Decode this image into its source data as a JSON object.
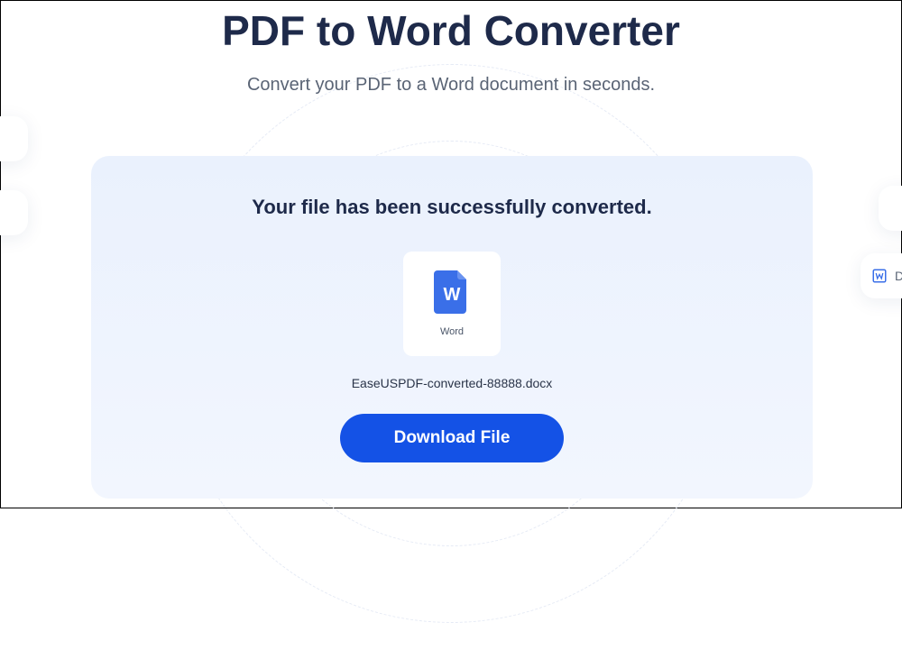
{
  "header": {
    "title": "PDF to Word Converter",
    "subtitle": "Convert your PDF to a Word document in seconds."
  },
  "card": {
    "success_message": "Your file has been successfully converted.",
    "file_type_label": "Word",
    "filename": "EaseUSPDF-converted-88888.docx",
    "download_label": "Download File"
  },
  "side": {
    "dropbox_label": "Drop"
  },
  "colors": {
    "accent": "#1452e6",
    "icon_blue": "#3a6fe8"
  }
}
